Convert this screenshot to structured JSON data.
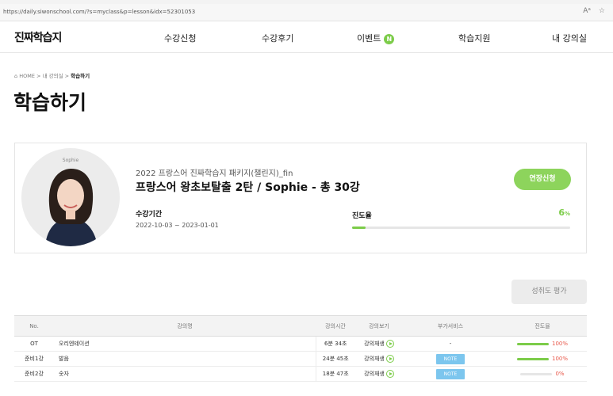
{
  "browser": {
    "url": "https://daily.siwonschool.com/?s=myclass&p=lesson&idx=52301053",
    "read_aloud_icon": "Aᵃ",
    "favorites_icon": "☆"
  },
  "header": {
    "logo": "진짜학습지",
    "nav": [
      {
        "label": "수강신청"
      },
      {
        "label": "수강후기"
      },
      {
        "label": "이벤트",
        "badge": "N"
      },
      {
        "label": "학습지원"
      },
      {
        "label": "내 강의실"
      }
    ]
  },
  "breadcrumb": {
    "home_icon": "⌂",
    "home": "HOME",
    "sep1": ">",
    "level2": "내 강의실",
    "sep2": ">",
    "current": "학습하기"
  },
  "page_title": "학습하기",
  "course": {
    "teacher_name": "Sophie",
    "subtitle": "2022 프랑스어 진짜학습지 패키지(챌린지)_fin",
    "title": "프랑스어 왕초보탈출 2탄 / Sophie - 총 30강",
    "extend_button": "연장신청",
    "period_label": "수강기간",
    "period_value": "2022-10-03 ~ 2023-01-01",
    "progress_label": "진도율",
    "progress_value": "6",
    "progress_unit": "%",
    "progress_fraction": 0.06
  },
  "eval_button": "성취도 평가",
  "table": {
    "headers": [
      "No.",
      "강의명",
      "강의시간",
      "강의보기",
      "부가서비스",
      "진도율"
    ],
    "rows": [
      {
        "no": "OT",
        "name": "오리엔테이션",
        "time": "6분 34초",
        "view": "강의재생",
        "extra": "-",
        "progress": "100%",
        "fraction": 1.0
      },
      {
        "no": "준비1강",
        "name": "발음",
        "time": "24분 45초",
        "view": "강의재생",
        "extra": "NOTE",
        "progress": "100%",
        "fraction": 1.0
      },
      {
        "no": "준비2강",
        "name": "숫자",
        "time": "18분 47초",
        "view": "강의재생",
        "extra": "NOTE",
        "progress": "0%",
        "fraction": 0.0
      }
    ]
  },
  "colors": {
    "accent_green": "#7ccc49",
    "note_blue": "#7cc6ee",
    "percent_red": "#e8584b"
  }
}
